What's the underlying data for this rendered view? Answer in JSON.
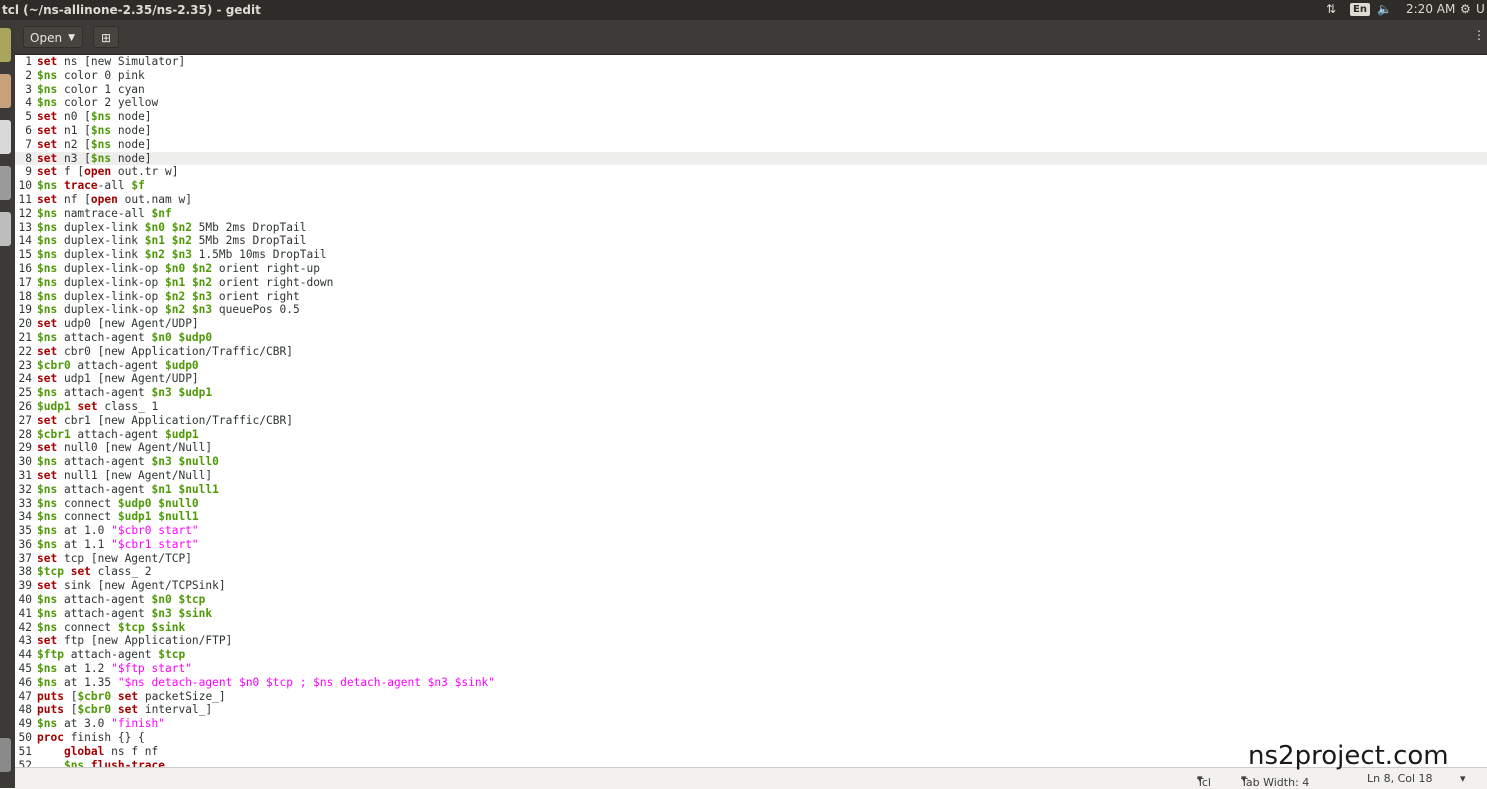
{
  "window": {
    "title": "tcl (~/ns-allinone-2.35/ns-2.35) - gedit"
  },
  "panel": {
    "keyboard_layout": "En",
    "time": "2:20 AM",
    "user_initial": "U"
  },
  "toolbar": {
    "open_label": "Open"
  },
  "editor": {
    "current_line": 8,
    "lines": [
      [
        [
          "kw",
          "set"
        ],
        [
          "t",
          " ns [new Simulator]"
        ]
      ],
      [
        [
          "v",
          "$ns"
        ],
        [
          "t",
          " color 0 pink"
        ]
      ],
      [
        [
          "v",
          "$ns"
        ],
        [
          "t",
          " color 1 cyan"
        ]
      ],
      [
        [
          "v",
          "$ns"
        ],
        [
          "t",
          " color 2 yellow"
        ]
      ],
      [
        [
          "kw",
          "set"
        ],
        [
          "t",
          " n0 ["
        ],
        [
          "v",
          "$ns"
        ],
        [
          "t",
          " node]"
        ]
      ],
      [
        [
          "kw",
          "set"
        ],
        [
          "t",
          " n1 ["
        ],
        [
          "v",
          "$ns"
        ],
        [
          "t",
          " node]"
        ]
      ],
      [
        [
          "kw",
          "set"
        ],
        [
          "t",
          " n2 ["
        ],
        [
          "v",
          "$ns"
        ],
        [
          "t",
          " node]"
        ]
      ],
      [
        [
          "kw",
          "set"
        ],
        [
          "t",
          " n3 ["
        ],
        [
          "v",
          "$ns"
        ],
        [
          "t",
          " node]"
        ]
      ],
      [
        [
          "kw",
          "set"
        ],
        [
          "t",
          " f ["
        ],
        [
          "kw",
          "open"
        ],
        [
          "t",
          " out.tr w]"
        ]
      ],
      [
        [
          "v",
          "$ns"
        ],
        [
          "t",
          " "
        ],
        [
          "kw",
          "trace"
        ],
        [
          "t",
          "-all "
        ],
        [
          "v",
          "$f"
        ]
      ],
      [
        [
          "kw",
          "set"
        ],
        [
          "t",
          " nf ["
        ],
        [
          "kw",
          "open"
        ],
        [
          "t",
          " out.nam w]"
        ]
      ],
      [
        [
          "v",
          "$ns"
        ],
        [
          "t",
          " namtrace-all "
        ],
        [
          "v",
          "$nf"
        ]
      ],
      [
        [
          "v",
          "$ns"
        ],
        [
          "t",
          " duplex-link "
        ],
        [
          "v",
          "$n0 $n2"
        ],
        [
          "t",
          " 5Mb 2ms DropTail"
        ]
      ],
      [
        [
          "v",
          "$ns"
        ],
        [
          "t",
          " duplex-link "
        ],
        [
          "v",
          "$n1 $n2"
        ],
        [
          "t",
          " 5Mb 2ms DropTail"
        ]
      ],
      [
        [
          "v",
          "$ns"
        ],
        [
          "t",
          " duplex-link "
        ],
        [
          "v",
          "$n2 $n3"
        ],
        [
          "t",
          " 1.5Mb 10ms DropTail"
        ]
      ],
      [
        [
          "v",
          "$ns"
        ],
        [
          "t",
          " duplex-link-op "
        ],
        [
          "v",
          "$n0 $n2"
        ],
        [
          "t",
          " orient right-up"
        ]
      ],
      [
        [
          "v",
          "$ns"
        ],
        [
          "t",
          " duplex-link-op "
        ],
        [
          "v",
          "$n1 $n2"
        ],
        [
          "t",
          " orient right-down"
        ]
      ],
      [
        [
          "v",
          "$ns"
        ],
        [
          "t",
          " duplex-link-op "
        ],
        [
          "v",
          "$n2 $n3"
        ],
        [
          "t",
          " orient right"
        ]
      ],
      [
        [
          "v",
          "$ns"
        ],
        [
          "t",
          " duplex-link-op "
        ],
        [
          "v",
          "$n2 $n3"
        ],
        [
          "t",
          " queuePos 0.5"
        ]
      ],
      [
        [
          "kw",
          "set"
        ],
        [
          "t",
          " udp0 [new Agent/UDP]"
        ]
      ],
      [
        [
          "v",
          "$ns"
        ],
        [
          "t",
          " attach-agent "
        ],
        [
          "v",
          "$n0 $udp0"
        ]
      ],
      [
        [
          "kw",
          "set"
        ],
        [
          "t",
          " cbr0 [new Application/Traffic/CBR]"
        ]
      ],
      [
        [
          "v",
          "$cbr0"
        ],
        [
          "t",
          " attach-agent "
        ],
        [
          "v",
          "$udp0"
        ]
      ],
      [
        [
          "kw",
          "set"
        ],
        [
          "t",
          " udp1 [new Agent/UDP]"
        ]
      ],
      [
        [
          "v",
          "$ns"
        ],
        [
          "t",
          " attach-agent "
        ],
        [
          "v",
          "$n3 $udp1"
        ]
      ],
      [
        [
          "v",
          "$udp1"
        ],
        [
          "t",
          " "
        ],
        [
          "kw",
          "set"
        ],
        [
          "t",
          " class_ 1"
        ]
      ],
      [
        [
          "kw",
          "set"
        ],
        [
          "t",
          " cbr1 [new Application/Traffic/CBR]"
        ]
      ],
      [
        [
          "v",
          "$cbr1"
        ],
        [
          "t",
          " attach-agent "
        ],
        [
          "v",
          "$udp1"
        ]
      ],
      [
        [
          "kw",
          "set"
        ],
        [
          "t",
          " null0 [new Agent/Null]"
        ]
      ],
      [
        [
          "v",
          "$ns"
        ],
        [
          "t",
          " attach-agent "
        ],
        [
          "v",
          "$n3 $null0"
        ]
      ],
      [
        [
          "kw",
          "set"
        ],
        [
          "t",
          " null1 [new Agent/Null]"
        ]
      ],
      [
        [
          "v",
          "$ns"
        ],
        [
          "t",
          " attach-agent "
        ],
        [
          "v",
          "$n1 $null1"
        ]
      ],
      [
        [
          "v",
          "$ns"
        ],
        [
          "t",
          " connect "
        ],
        [
          "v",
          "$udp0 $null0"
        ]
      ],
      [
        [
          "v",
          "$ns"
        ],
        [
          "t",
          " connect "
        ],
        [
          "v",
          "$udp1 $null1"
        ]
      ],
      [
        [
          "v",
          "$ns"
        ],
        [
          "t",
          " at 1.0 "
        ],
        [
          "s",
          "\"$cbr0 start\""
        ]
      ],
      [
        [
          "v",
          "$ns"
        ],
        [
          "t",
          " at 1.1 "
        ],
        [
          "s",
          "\"$cbr1 start\""
        ]
      ],
      [
        [
          "kw",
          "set"
        ],
        [
          "t",
          " tcp [new Agent/TCP]"
        ]
      ],
      [
        [
          "v",
          "$tcp"
        ],
        [
          "t",
          " "
        ],
        [
          "kw",
          "set"
        ],
        [
          "t",
          " class_ 2"
        ]
      ],
      [
        [
          "kw",
          "set"
        ],
        [
          "t",
          " sink [new Agent/TCPSink]"
        ]
      ],
      [
        [
          "v",
          "$ns"
        ],
        [
          "t",
          " attach-agent "
        ],
        [
          "v",
          "$n0 $tcp"
        ]
      ],
      [
        [
          "v",
          "$ns"
        ],
        [
          "t",
          " attach-agent "
        ],
        [
          "v",
          "$n3 $sink"
        ]
      ],
      [
        [
          "v",
          "$ns"
        ],
        [
          "t",
          " connect "
        ],
        [
          "v",
          "$tcp $sink"
        ]
      ],
      [
        [
          "kw",
          "set"
        ],
        [
          "t",
          " ftp [new Application/FTP]"
        ]
      ],
      [
        [
          "v",
          "$ftp"
        ],
        [
          "t",
          " attach-agent "
        ],
        [
          "v",
          "$tcp"
        ]
      ],
      [
        [
          "v",
          "$ns"
        ],
        [
          "t",
          " at 1.2 "
        ],
        [
          "s",
          "\"$ftp start\""
        ]
      ],
      [
        [
          "v",
          "$ns"
        ],
        [
          "t",
          " at 1.35 "
        ],
        [
          "s",
          "\"$ns detach-agent $n0 $tcp ; $ns detach-agent $n3 $sink\""
        ]
      ],
      [
        [
          "kw",
          "puts"
        ],
        [
          "t",
          " ["
        ],
        [
          "v",
          "$cbr0"
        ],
        [
          "t",
          " "
        ],
        [
          "kw",
          "set"
        ],
        [
          "t",
          " packetSize_]"
        ]
      ],
      [
        [
          "kw",
          "puts"
        ],
        [
          "t",
          " ["
        ],
        [
          "v",
          "$cbr0"
        ],
        [
          "t",
          " "
        ],
        [
          "kw",
          "set"
        ],
        [
          "t",
          " interval_]"
        ]
      ],
      [
        [
          "v",
          "$ns"
        ],
        [
          "t",
          " at 3.0 "
        ],
        [
          "s",
          "\"finish\""
        ]
      ],
      [
        [
          "kw",
          "proc"
        ],
        [
          "t",
          " finish {} {"
        ]
      ],
      [
        [
          "t",
          "    "
        ],
        [
          "kw",
          "global"
        ],
        [
          "t",
          " ns f nf"
        ]
      ],
      [
        [
          "t",
          "    "
        ],
        [
          "v",
          "$ns"
        ],
        [
          "t",
          " "
        ],
        [
          "kw",
          "flush-trace"
        ]
      ]
    ]
  },
  "statusbar": {
    "language": "Tcl",
    "tab_width": "Tab Width: 4",
    "position": "Ln 8, Col 18"
  },
  "watermark": "ns2project.com",
  "colors": {
    "keyword": "#a40000",
    "variable": "#4e9a06",
    "string": "#ff00ff",
    "current_line": "#eeeeec"
  }
}
